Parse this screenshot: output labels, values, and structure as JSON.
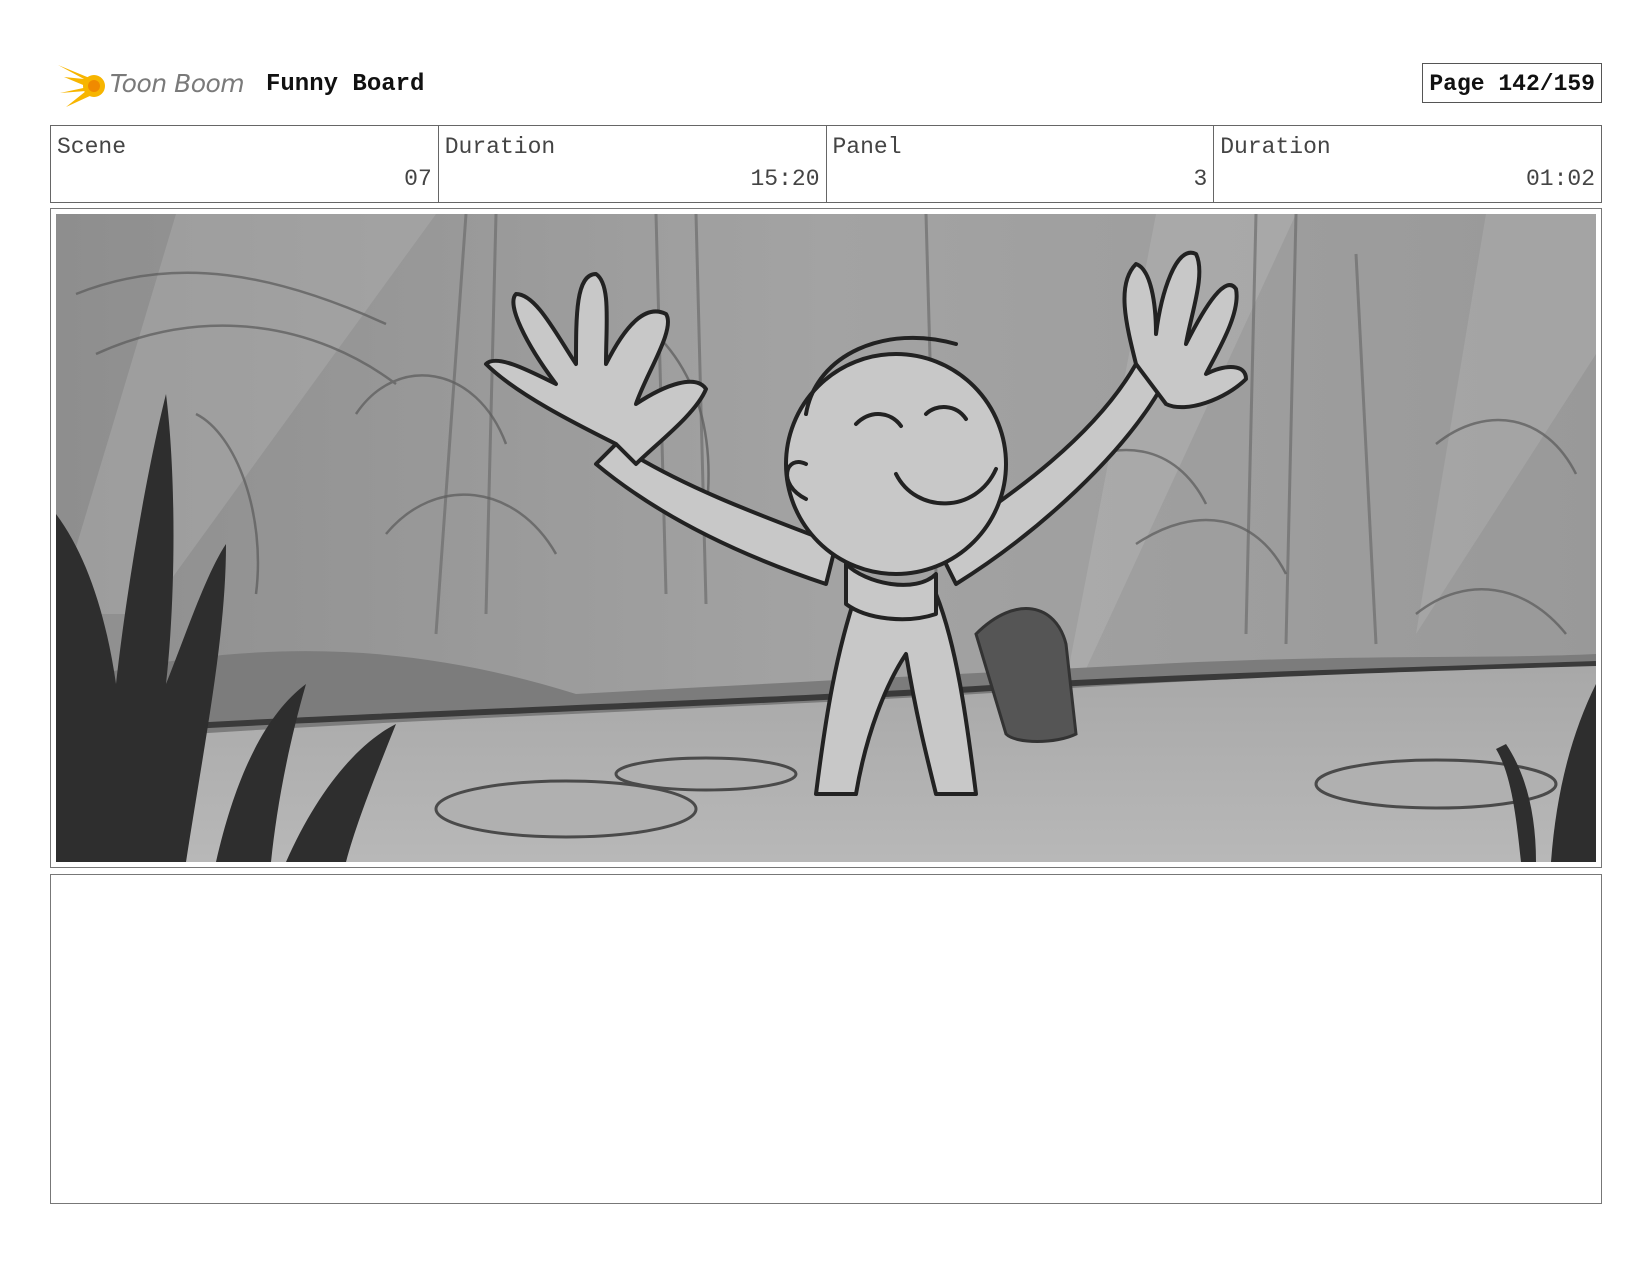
{
  "header": {
    "logo_text": "Toon Boom",
    "project_title": "Funny Board",
    "page_label": "Page 142/159"
  },
  "info": [
    {
      "label": "Scene",
      "value": "07"
    },
    {
      "label": "Duration",
      "value": "15:20"
    },
    {
      "label": "Panel",
      "value": "3"
    },
    {
      "label": "Duration",
      "value": "01:02"
    }
  ],
  "colors": {
    "logo_yellow": "#f7b500",
    "logo_orange": "#f08a00",
    "border": "#666666"
  },
  "notes": {
    "text": ""
  }
}
